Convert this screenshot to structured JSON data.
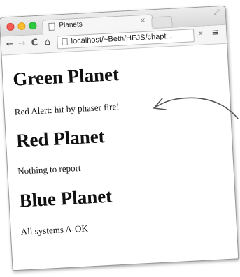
{
  "browser": {
    "tab_title": "Planets",
    "tab_close": "×",
    "url": "localhost/~Beth/HFJS/chapt...",
    "overflow_label": "»",
    "menu_label": "≡",
    "nav": {
      "back": "←",
      "forward": "→",
      "reload": "C",
      "home": "⌂"
    }
  },
  "page": {
    "planets": [
      {
        "name": "Green Planet",
        "status": "Red Alert: hit by phaser fire!"
      },
      {
        "name": "Red Planet",
        "status": "Nothing to report"
      },
      {
        "name": "Blue Planet",
        "status": "All systems A-OK"
      }
    ]
  },
  "icons": {
    "resize": "resize-icon",
    "page": "page-icon",
    "home": "home-icon",
    "menu": "menu-icon"
  },
  "colors": {
    "close": "#f45c54",
    "minimize": "#fbbd2e",
    "zoom": "#2dc840",
    "annotation_arrow": "#555555"
  }
}
